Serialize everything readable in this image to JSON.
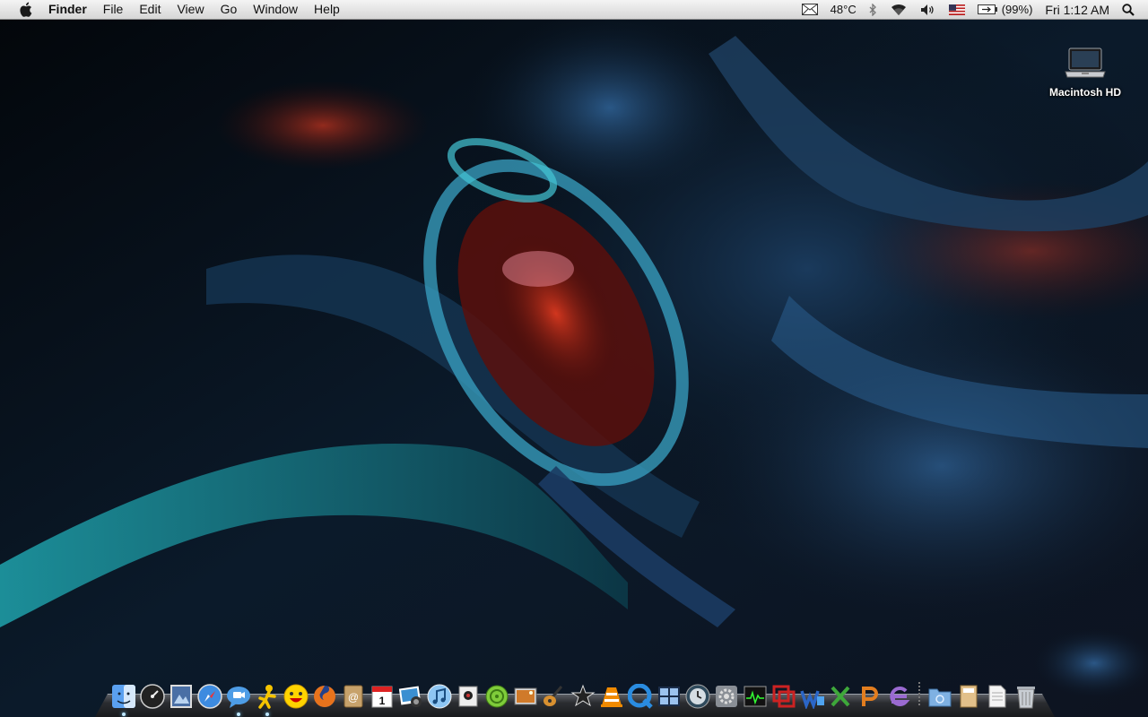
{
  "menubar": {
    "app_name": "Finder",
    "menus": [
      "File",
      "Edit",
      "View",
      "Go",
      "Window",
      "Help"
    ],
    "status": {
      "temperature": "48°C",
      "battery": "(99%)",
      "clock": "Fri 1:12 AM"
    }
  },
  "desktop": {
    "icons": [
      {
        "label": "Macintosh HD",
        "icon": "hard-drive-icon"
      }
    ]
  },
  "dock": {
    "items": [
      {
        "icon": "finder-icon",
        "running": true
      },
      {
        "icon": "dashboard-icon",
        "running": false
      },
      {
        "icon": "preview-icon",
        "running": false
      },
      {
        "icon": "safari-icon",
        "running": false
      },
      {
        "icon": "ichat-icon",
        "running": true
      },
      {
        "icon": "aim-icon",
        "running": true
      },
      {
        "icon": "yahoo-messenger-icon",
        "running": false
      },
      {
        "icon": "firefox-icon",
        "running": false
      },
      {
        "icon": "address-book-icon",
        "running": false
      },
      {
        "icon": "ical-icon",
        "running": false
      },
      {
        "icon": "iphoto-icon",
        "running": false
      },
      {
        "icon": "itunes-icon",
        "running": false
      },
      {
        "icon": "photo-booth-icon",
        "running": false
      },
      {
        "icon": "network-icon",
        "running": false
      },
      {
        "icon": "image-capture-icon",
        "running": false
      },
      {
        "icon": "garageband-icon",
        "running": false
      },
      {
        "icon": "imovie-icon",
        "running": false
      },
      {
        "icon": "vlc-icon",
        "running": false
      },
      {
        "icon": "quicktime-icon",
        "running": false
      },
      {
        "icon": "spaces-icon",
        "running": false
      },
      {
        "icon": "time-machine-icon",
        "running": false
      },
      {
        "icon": "system-preferences-icon",
        "running": false
      },
      {
        "icon": "activity-monitor-icon",
        "running": false
      },
      {
        "icon": "parallels-icon",
        "running": false
      },
      {
        "icon": "word-icon",
        "running": false
      },
      {
        "icon": "excel-icon",
        "running": false
      },
      {
        "icon": "powerpoint-icon",
        "running": false
      },
      {
        "icon": "entourage-icon",
        "running": false
      },
      {
        "icon": "applications-folder-icon",
        "running": false
      },
      {
        "icon": "documents-stack-icon",
        "running": false
      },
      {
        "icon": "pages-document-icon",
        "running": false
      },
      {
        "icon": "trash-icon",
        "running": false
      }
    ]
  },
  "colors": {
    "menubar_bg": "#e5e5e5",
    "wallpaper_blue": "#2a5a8a",
    "wallpaper_red": "#b02a18",
    "wallpaper_teal": "#2fa6b0"
  }
}
